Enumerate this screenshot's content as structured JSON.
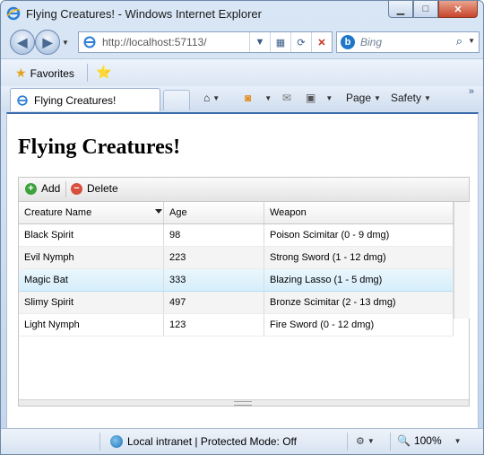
{
  "window": {
    "title": "Flying Creatures! - Windows Internet Explorer",
    "caption_min": "▁",
    "caption_max": "□",
    "caption_close": "✕"
  },
  "nav": {
    "back_icon": "back-arrow-icon",
    "forward_icon": "forward-arrow-icon",
    "address": "http://localhost:57113/",
    "search_placeholder": "Bing",
    "search_logo": "b"
  },
  "favorites_bar": {
    "favorites_label": "Favorites"
  },
  "tabs": [
    {
      "label": "Flying Creatures!"
    }
  ],
  "commands": {
    "page_label": "Page",
    "safety_label": "Safety",
    "overflow": "»"
  },
  "page": {
    "heading": "Flying Creatures!"
  },
  "grid": {
    "toolbar": {
      "add_label": "Add",
      "delete_label": "Delete"
    },
    "columns": [
      "Creature Name",
      "Age",
      "Weapon"
    ],
    "sorted_column": "Creature Name",
    "selected_row": 2,
    "rows": [
      [
        "Black Spirit",
        "98",
        "Poison Scimitar (0 - 9 dmg)"
      ],
      [
        "Evil Nymph",
        "223",
        "Strong Sword (1 - 12 dmg)"
      ],
      [
        "Magic Bat",
        "333",
        "Blazing Lasso (1 - 5 dmg)"
      ],
      [
        "Slimy Spirit",
        "497",
        "Bronze Scimitar (2 - 13 dmg)"
      ],
      [
        "Light Nymph",
        "123",
        "Fire Sword (0 - 12 dmg)"
      ]
    ]
  },
  "status": {
    "zone_text": "Local intranet | Protected Mode: Off",
    "zoom": "100%"
  },
  "colors": {
    "selection": "#d6eefb",
    "add_green": "#3ca33c",
    "delete_red": "#d8503c",
    "window_frame": "#c4d6ec"
  }
}
